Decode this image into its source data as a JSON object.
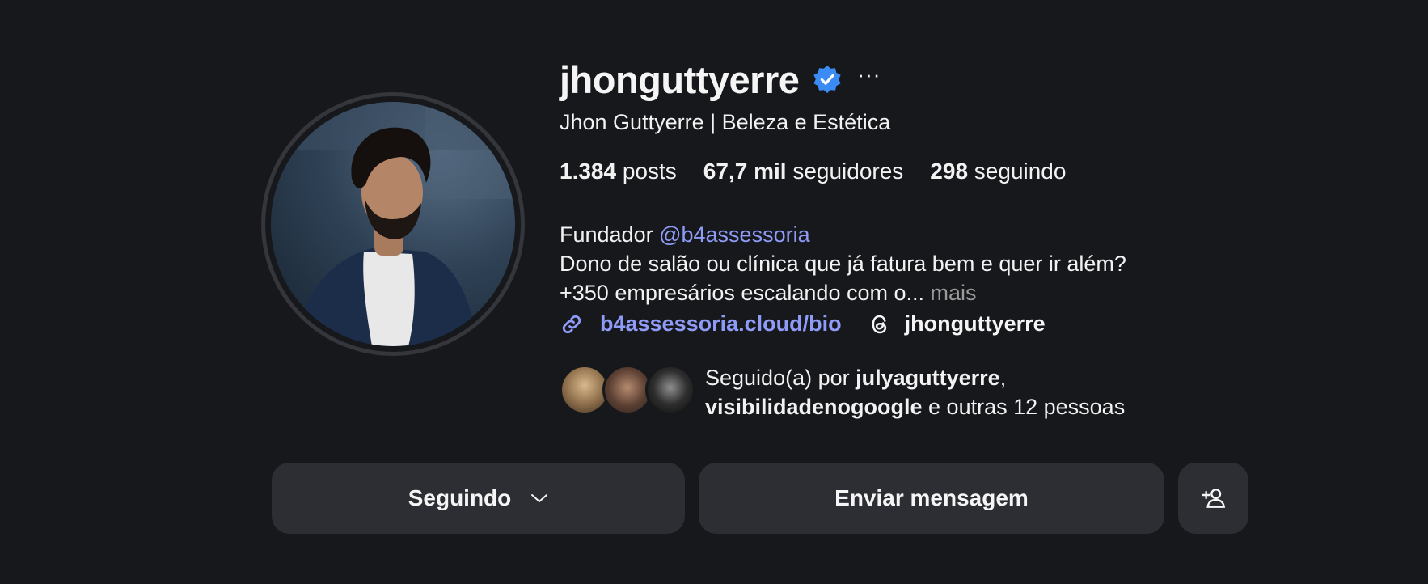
{
  "profile": {
    "username": "jhonguttyerre",
    "full_name": "Jhon Guttyerre | Beleza e Estética",
    "more_glyph": "···"
  },
  "stats": {
    "posts_count": "1.384",
    "posts_label": "posts",
    "followers_count": "67,7 mil",
    "followers_label": "seguidores",
    "following_count": "298",
    "following_label": "seguindo"
  },
  "bio": {
    "line1_prefix": "Fundador ",
    "mention": "@b4assessoria",
    "line2": "Dono de salão ou clínica que já fatura bem e quer ir além?",
    "line3": "+350 empresários escalando com o... ",
    "more_label": "mais"
  },
  "links": {
    "website": "b4assessoria.cloud/bio",
    "threads_handle": "jhonguttyerre"
  },
  "followed_by": {
    "prefix": "Seguido(a) por ",
    "user1": "julyaguttyerre",
    "separator": ",",
    "user2": "visibilidadenogoogle",
    "suffix": " e outras 12 pessoas"
  },
  "actions": {
    "following_label": "Seguindo",
    "message_label": "Enviar mensagem"
  },
  "colors": {
    "background": "#17181c",
    "button_bg": "#2c2e33",
    "link": "#8f9cf7",
    "verified": "#3b8bf5"
  },
  "icons": [
    "verified-badge-icon",
    "more-options-icon",
    "link-icon",
    "threads-icon",
    "chevron-down-icon",
    "add-person-icon"
  ]
}
